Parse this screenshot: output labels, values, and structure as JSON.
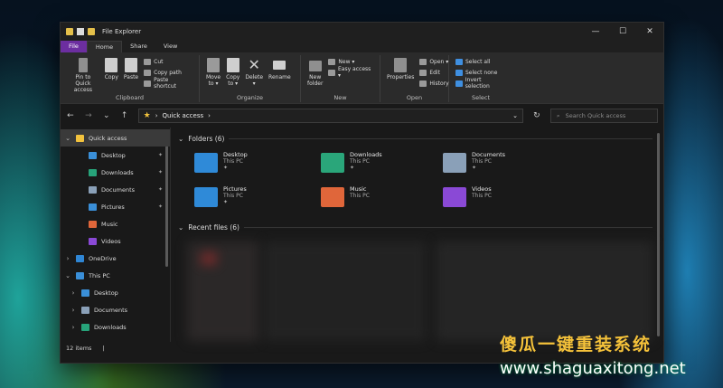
{
  "window": {
    "title": "File Explorer",
    "controls": {
      "minimize": "—",
      "maximize": "☐",
      "close": "✕"
    }
  },
  "ribbon_tabs": [
    "File",
    "Home",
    "Share",
    "View"
  ],
  "ribbon": {
    "clipboard": {
      "label": "Clipboard",
      "pin": "Pin to Quick\naccess",
      "copy": "Copy",
      "paste": "Paste",
      "cut": "Cut",
      "copy_path": "Copy path",
      "paste_shortcut": "Paste shortcut"
    },
    "organize": {
      "label": "Organize",
      "move_to": "Move\nto ▾",
      "copy_to": "Copy\nto ▾",
      "delete": "Delete\n▾",
      "rename": "Rename"
    },
    "new": {
      "label": "New",
      "new_folder": "New\nfolder",
      "new_item": "New ▾",
      "easy_access": "Easy access ▾"
    },
    "open": {
      "label": "Open",
      "properties": "Properties",
      "open": "Open ▾",
      "edit": "Edit",
      "history": "History"
    },
    "select": {
      "label": "Select",
      "select_all": "Select all",
      "select_none": "Select none",
      "invert": "Invert selection"
    }
  },
  "address": {
    "back": "←",
    "forward": "→",
    "up_list": "⌄",
    "up": "↑",
    "path_root": "›",
    "path": "Quick access",
    "path_chevron": "›",
    "dropdown": "⌄",
    "refresh": "↻",
    "search_placeholder": "Search Quick access"
  },
  "sidebar": {
    "items": [
      {
        "label": "Quick access",
        "caret": "⌄",
        "pinned": false,
        "color": "#f2c23d"
      },
      {
        "label": "Desktop",
        "caret": "",
        "pinned": true,
        "color": "#3a8fd8"
      },
      {
        "label": "Downloads",
        "caret": "",
        "pinned": true,
        "color": "#27a37a"
      },
      {
        "label": "Documents",
        "caret": "",
        "pinned": true,
        "color": "#8aa0b8"
      },
      {
        "label": "Pictures",
        "caret": "",
        "pinned": true,
        "color": "#3a8fd8"
      },
      {
        "label": "Music",
        "caret": "",
        "pinned": false,
        "color": "#e0663a"
      },
      {
        "label": "Videos",
        "caret": "",
        "pinned": false,
        "color": "#8a49d6"
      },
      {
        "label": "OneDrive",
        "caret": "›",
        "pinned": false,
        "color": "#2f86d4"
      },
      {
        "label": "This PC",
        "caret": "⌄",
        "pinned": false,
        "color": "#3a8fd8"
      },
      {
        "label": "Desktop",
        "caret": "›",
        "pinned": false,
        "color": "#3a8fd8"
      },
      {
        "label": "Documents",
        "caret": "›",
        "pinned": false,
        "color": "#8aa0b8"
      },
      {
        "label": "Downloads",
        "caret": "›",
        "pinned": false,
        "color": "#27a37a"
      }
    ],
    "pin_glyph": "📌"
  },
  "main": {
    "folders_header": "Folders (6)",
    "recent_header": "Recent files (6)",
    "section_caret": "⌄",
    "folders": [
      {
        "name": "Desktop",
        "location": "This PC",
        "pinned": true,
        "color": "#2f8ad8"
      },
      {
        "name": "Downloads",
        "location": "This PC",
        "pinned": true,
        "color": "#2aa67a"
      },
      {
        "name": "Documents",
        "location": "This PC",
        "pinned": true,
        "color": "#8aa0b8"
      },
      {
        "name": "Pictures",
        "location": "This PC",
        "pinned": true,
        "color": "#2f8ad8"
      },
      {
        "name": "Music",
        "location": "This PC",
        "pinned": false,
        "color": "#e0663a"
      },
      {
        "name": "Videos",
        "location": "This PC",
        "pinned": false,
        "color": "#8a49d6"
      }
    ]
  },
  "status": {
    "items": "12 items",
    "sep": "|"
  },
  "watermark": {
    "line1": "傻瓜一键重装系统",
    "line2": "www.shaguaxitong.net"
  }
}
